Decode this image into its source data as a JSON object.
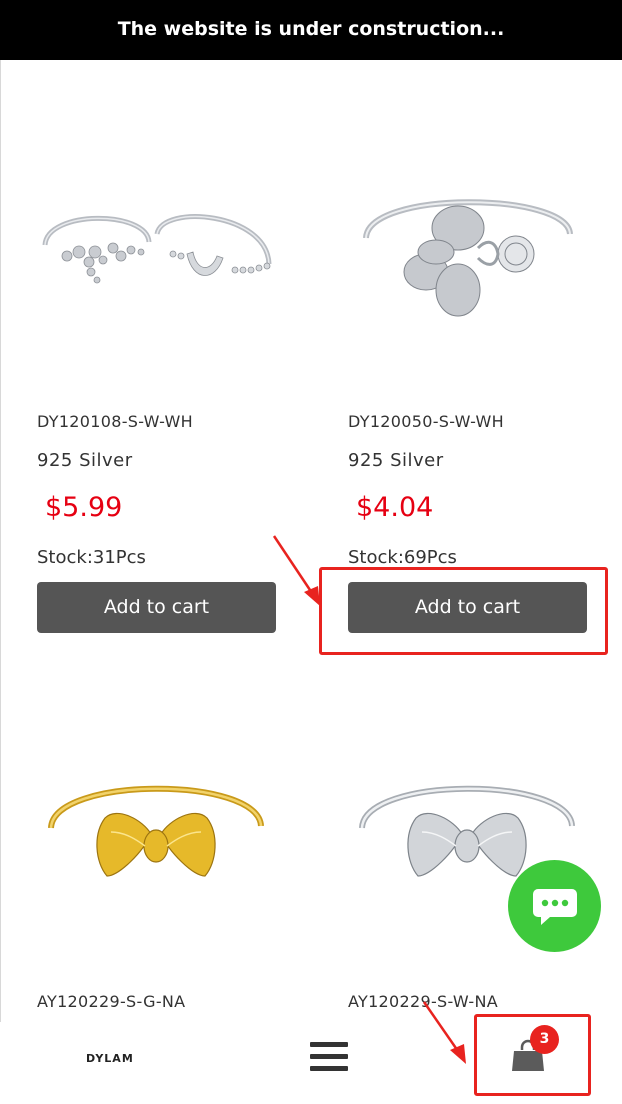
{
  "banner": {
    "text": "The website is under construction..."
  },
  "products": [
    {
      "sku": "DY120108-S-W-WH",
      "material": "925 Silver",
      "price": "$5.99",
      "stock": "Stock:31Pcs",
      "button": "Add to cart",
      "image": "silver-twin-ring-set-image"
    },
    {
      "sku": "DY120050-S-W-WH",
      "material": "925 Silver",
      "price": "$4.04",
      "stock": "Stock:69Pcs",
      "button": "Add to cart",
      "image": "silver-bee-ring-image"
    },
    {
      "sku": "AY120229-S-G-NA",
      "image": "gold-bow-ring-image"
    },
    {
      "sku": "AY120229-S-W-NA",
      "image": "silver-bow-ring-image"
    }
  ],
  "bottom_nav": {
    "logo": "DYLAM",
    "menu_icon": "hamburger-menu-icon",
    "cart_icon": "shopping-bag-icon",
    "cart_count": "3"
  },
  "chat": {
    "icon": "chat-bubble-icon"
  },
  "colors": {
    "price": "#e60012",
    "button": "#555555",
    "chat": "#3ec93c",
    "annotation": "#e8231f"
  }
}
